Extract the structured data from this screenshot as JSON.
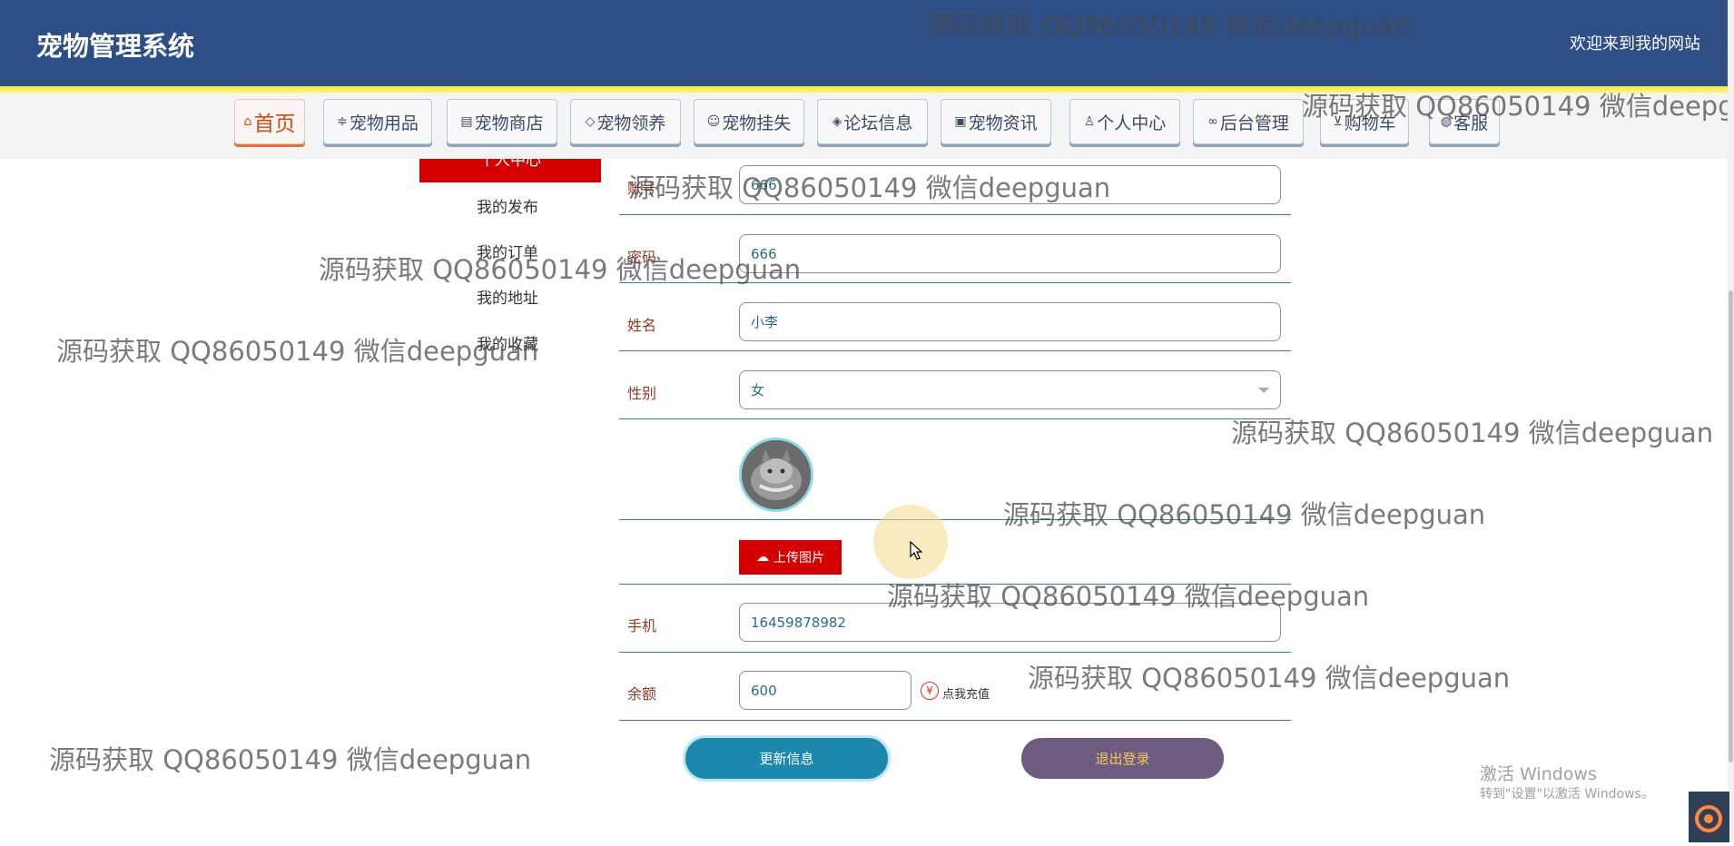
{
  "header": {
    "title": "宠物管理系统",
    "welcome": "欢迎来到我的网站"
  },
  "nav": {
    "items": [
      {
        "icon": "home-icon",
        "label": "首页",
        "active": true
      },
      {
        "icon": "sliders-icon",
        "label": "宠物用品"
      },
      {
        "icon": "shop-icon",
        "label": "宠物商店"
      },
      {
        "icon": "box-icon",
        "label": "宠物领养"
      },
      {
        "icon": "face-icon",
        "label": "宠物挂失"
      },
      {
        "icon": "tag-icon",
        "label": "论坛信息"
      },
      {
        "icon": "news-icon",
        "label": "宠物资讯"
      },
      {
        "icon": "user-icon",
        "label": "个人中心"
      },
      {
        "icon": "link-icon",
        "label": "后台管理"
      },
      {
        "icon": "cart-icon",
        "label": "购物车"
      },
      {
        "icon": "chat-icon",
        "label": "客服"
      }
    ]
  },
  "sidebar": {
    "active": "个人中心",
    "links": [
      "我的发布",
      "我的订单",
      "我的地址",
      "我的收藏"
    ]
  },
  "form": {
    "account_label": "账号",
    "account_value": "666",
    "password_label": "密码",
    "password_value": "666",
    "name_label": "姓名",
    "name_value": "小李",
    "gender_label": "性别",
    "gender_value": "女",
    "upload_label": "上传图片",
    "phone_label": "手机",
    "phone_value": "16459878982",
    "balance_label": "余额",
    "balance_value": "600",
    "recharge_label": "点我充值",
    "update_button": "更新信息",
    "logout_button": "退出登录"
  },
  "watermark": "源码获取 QQ86050149 微信deepguan",
  "windows": {
    "activate_title": "激活 Windows",
    "activate_hint": "转到\"设置\"以激活 Windows。"
  },
  "colors": {
    "header_bg": "#2d4f86",
    "accent_red": "#d50000",
    "update_btn": "#1c88ad",
    "logout_btn": "#6e5b81"
  }
}
